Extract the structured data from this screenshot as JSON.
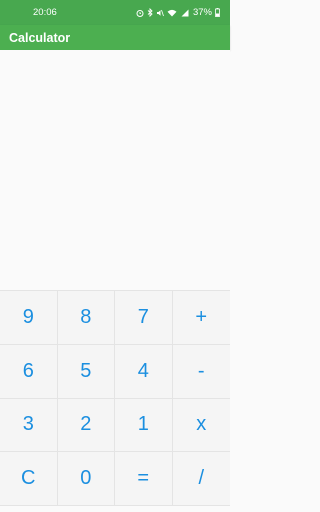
{
  "status_bar": {
    "time": "20:06",
    "battery": "37%",
    "icons": [
      "alarm-icon",
      "bluetooth-icon",
      "mute-icon",
      "wifi-icon",
      "signal-icon",
      "battery-icon"
    ]
  },
  "app_bar": {
    "title": "Calculator"
  },
  "colors": {
    "app_bar": "#4caf50",
    "key_text": "#1b8fe0",
    "background": "#fafafa"
  },
  "keypad": {
    "keys": [
      {
        "label": "9",
        "name": "key-9"
      },
      {
        "label": "8",
        "name": "key-8"
      },
      {
        "label": "7",
        "name": "key-7"
      },
      {
        "label": "+",
        "name": "key-add"
      },
      {
        "label": "6",
        "name": "key-6"
      },
      {
        "label": "5",
        "name": "key-5"
      },
      {
        "label": "4",
        "name": "key-4"
      },
      {
        "label": "-",
        "name": "key-subtract"
      },
      {
        "label": "3",
        "name": "key-3"
      },
      {
        "label": "2",
        "name": "key-2"
      },
      {
        "label": "1",
        "name": "key-1"
      },
      {
        "label": "x",
        "name": "key-multiply"
      },
      {
        "label": "C",
        "name": "key-clear"
      },
      {
        "label": "0",
        "name": "key-0"
      },
      {
        "label": "=",
        "name": "key-equals"
      },
      {
        "label": "/",
        "name": "key-divide"
      }
    ]
  }
}
